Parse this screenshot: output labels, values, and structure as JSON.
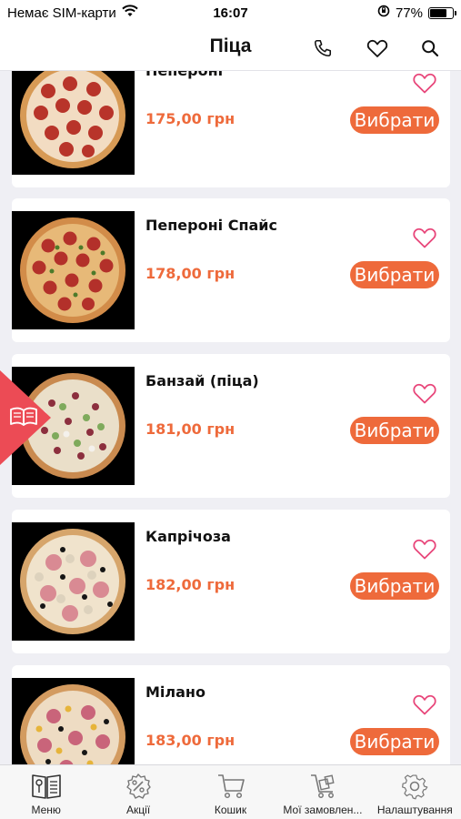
{
  "status_bar": {
    "carrier": "Немає SIM-карти",
    "time": "16:07",
    "battery": "77%",
    "battery_level": 0.77
  },
  "header": {
    "title": "Піца",
    "icons": [
      "phone-icon",
      "heart-icon",
      "search-icon"
    ]
  },
  "products": [
    {
      "name": "Пепероні",
      "price": "175,00 грн",
      "button": "Вибрати"
    },
    {
      "name": "Пепероні Спайс",
      "price": "178,00 грн",
      "button": "Вибрати"
    },
    {
      "name": "Банзай (піца)",
      "price": "181,00 грн",
      "button": "Вибрати"
    },
    {
      "name": "Капрічоза",
      "price": "182,00 грн",
      "button": "Вибрати"
    },
    {
      "name": "Мілано",
      "price": "183,00 грн",
      "button": "Вибрати"
    }
  ],
  "tabs": [
    {
      "label": "Меню",
      "icon": "menu-book-icon"
    },
    {
      "label": "Акції",
      "icon": "discount-icon"
    },
    {
      "label": "Кошик",
      "icon": "cart-icon"
    },
    {
      "label": "Мої замовлен...",
      "icon": "orders-icon"
    },
    {
      "label": "Налаштування",
      "icon": "gear-icon"
    }
  ],
  "colors": {
    "accent": "#ee6a3b",
    "heart": "#e8467a",
    "side_badge": "#ec4b55"
  }
}
